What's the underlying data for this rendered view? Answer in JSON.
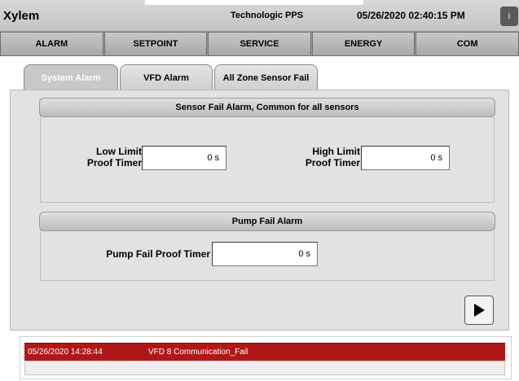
{
  "header": {
    "app_name": "Xylem",
    "station": "Technologic PPS",
    "datetime": "05/26/2020 02:40:15 PM",
    "info_glyph": "i"
  },
  "main_nav": {
    "items": [
      {
        "label": "ALARM"
      },
      {
        "label": "SETPOINT"
      },
      {
        "label": "SERVICE"
      },
      {
        "label": "ENERGY"
      },
      {
        "label": "COM"
      }
    ]
  },
  "sub_tabs": [
    {
      "label": "System Alarm",
      "active": true
    },
    {
      "label": "VFD Alarm",
      "active": false
    },
    {
      "label": "All Zone Sensor Fail",
      "active": false
    }
  ],
  "sensor_group": {
    "title": "Sensor Fail Alarm, Common for all sensors",
    "low_limit_label": "Low Limit\nProof Timer",
    "low_limit_value": "0 s",
    "high_limit_label": "High Limit\nProof Timer",
    "high_limit_value": "0 s"
  },
  "pump_group": {
    "title": "Pump Fail Alarm",
    "pump_fail_label": "Pump Fail Proof Timer",
    "pump_fail_value": "0 s"
  },
  "alarm_banner": {
    "timestamp": "05/26/2020 14:28:44",
    "message": "VFD 8 Communication_Fail",
    "color": "#b01818"
  },
  "icons": {
    "next": "play-triangle"
  }
}
